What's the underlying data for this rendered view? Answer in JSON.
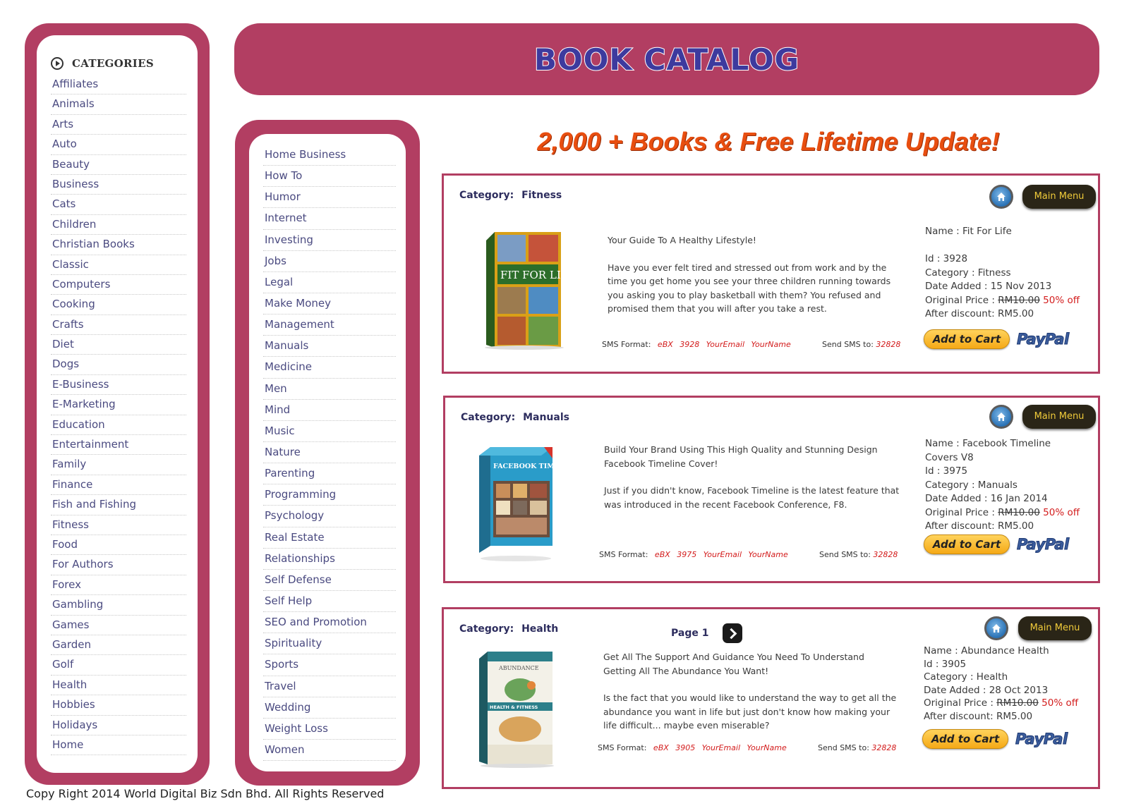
{
  "header": {
    "title": "BOOK CATALOG"
  },
  "promo": "2,000 + Books & Free Lifetime Update!",
  "sidebar_left": {
    "heading": "CATEGORIES",
    "items": [
      "Affiliates",
      "Animals",
      "Arts",
      "Auto",
      "Beauty",
      "Business",
      "Cats",
      "Children",
      "Christian Books",
      "Classic",
      "Computers",
      "Cooking",
      "Crafts",
      "Diet",
      "Dogs",
      "E-Business",
      "E-Marketing",
      "Education",
      "Entertainment",
      "Family",
      "Finance",
      "Fish and Fishing",
      "Fitness",
      "Food",
      "For Authors",
      "Forex",
      "Gambling",
      "Games",
      "Garden",
      "Golf",
      "Health",
      "Hobbies",
      "Holidays",
      "Home"
    ]
  },
  "sidebar_mid": {
    "items": [
      "Home Business",
      "How To",
      "Humor",
      "Internet",
      "Investing",
      "Jobs",
      "Legal",
      "Make Money",
      "Management",
      "Manuals",
      "Medicine",
      "Men",
      "Mind",
      "Music",
      "Nature",
      "Parenting",
      "Programming",
      "Psychology",
      "Real Estate",
      "Relationships",
      "Self Defense",
      "Self Help",
      "SEO and Promotion",
      "Spirituality",
      "Sports",
      "Travel",
      "Wedding",
      "Weight Loss",
      "Women"
    ]
  },
  "common": {
    "category_label": "Category:",
    "main_menu": "Main Menu",
    "sms_format_label": "SMS Format:",
    "sms_email": "YourEmail",
    "sms_name": "YourName",
    "send_sms_label": "Send SMS to:",
    "send_sms_number": "32828",
    "add_to_cart": "Add to Cart",
    "paypal": "PayPal",
    "original_price_label": "Original Price :",
    "original_price": "RM10.00",
    "discount": "50% off",
    "after_discount": "After discount: RM5.00"
  },
  "products": [
    {
      "category": "Fitness",
      "cover_title": "FIT FOR LIFE",
      "description": [
        "Your Guide To A Healthy Lifestyle!",
        "Have you ever felt tired and stressed out from work and by the time you get home you see your three children running towards you asking you to play basketball with them? You refused and promised them that you will after you take a rest."
      ],
      "sms_code": "eBX",
      "sms_id": "3928",
      "name": "Name : Fit For Life",
      "id": "Id : 3928",
      "category_line": "Category : Fitness",
      "date_added": "Date Added : 15 Nov 2013"
    },
    {
      "category": "Manuals",
      "cover_title": "FACEBOOK TIMELINE",
      "description": [
        "Build Your Brand Using This High Quality and Stunning Design Facebook Timeline Cover!",
        "Just if you didn't know, Facebook Timeline is the latest feature that was introduced in the recent Facebook Conference, F8."
      ],
      "sms_code": "eBX",
      "sms_id": "3975",
      "name": "Name : Facebook Timeline",
      "name_cont": "Covers V8",
      "id": "Id : 3975",
      "category_line": "Category : Manuals",
      "date_added": "Date Added : 16 Jan 2014"
    },
    {
      "category": "Health",
      "page_label": "Page 1",
      "cover_title": "ABUNDANCE",
      "cover_subtitle": "HEALTH & FITNESS",
      "description": [
        "Get All The Support And Guidance You Need To Understand Getting All The Abundance You Want!",
        "Is the fact that you would like to understand the way to get all the abundance you want in life but just don't know how making your life difficult... maybe even miserable?"
      ],
      "sms_code": "eBX",
      "sms_id": "3905",
      "name": "Name : Abundance Health",
      "id": "Id : 3905",
      "category_line": "Category : Health",
      "date_added": "Date Added : 28 Oct 2013"
    }
  ],
  "footer": "Copy Right 2014 World Digital Biz Sdn Bhd.  All Rights Reserved",
  "colors": {
    "frame": "#b23e62",
    "title": "#3d3a9e",
    "promo": "#e84e10",
    "link": "#4a4a80",
    "sms_red": "#d31c1c"
  }
}
